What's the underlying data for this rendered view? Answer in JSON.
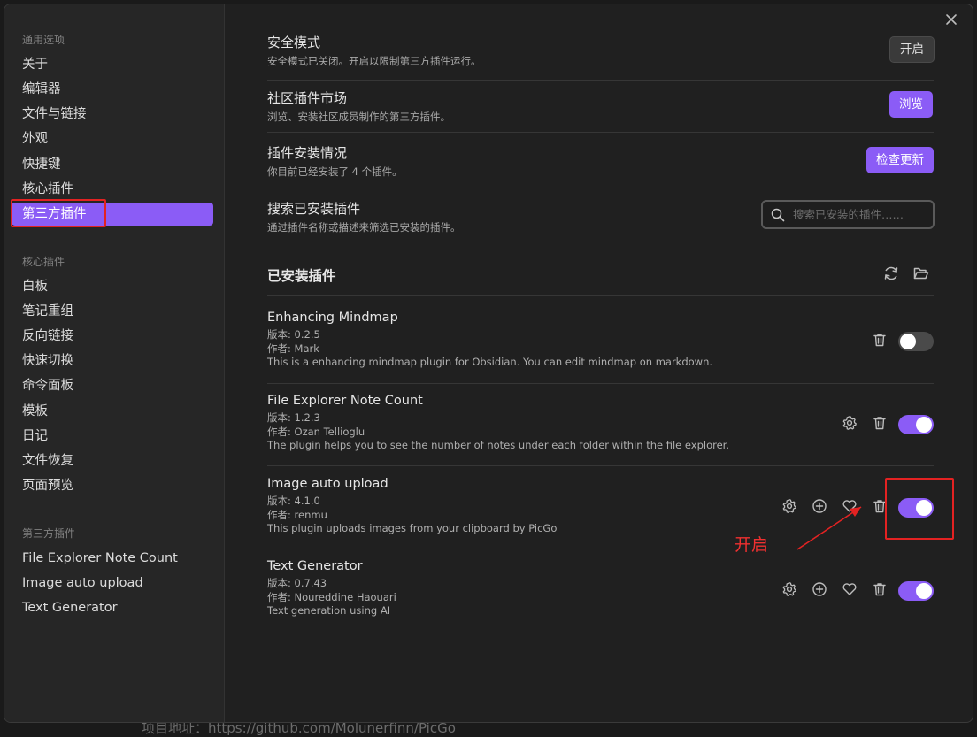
{
  "background_text": "项目地址：https://github.com/Molunerfinn/PicGo",
  "sidebar": {
    "sections": [
      {
        "heading": "通用选项",
        "items": [
          "关于",
          "编辑器",
          "文件与链接",
          "外观",
          "快捷键",
          "核心插件",
          "第三方插件"
        ]
      },
      {
        "heading": "核心插件",
        "items": [
          "白板",
          "笔记重组",
          "反向链接",
          "快速切换",
          "命令面板",
          "模板",
          "日记",
          "文件恢复",
          "页面预览"
        ]
      },
      {
        "heading": "第三方插件",
        "items": [
          "File Explorer Note Count",
          "Image auto upload",
          "Text Generator"
        ]
      }
    ],
    "active_item": "第三方插件"
  },
  "settings": {
    "safe_mode": {
      "title": "安全模式",
      "desc": "安全模式已关闭。开启以限制第三方插件运行。",
      "button": "开启"
    },
    "community": {
      "title": "社区插件市场",
      "desc": "浏览、安装社区成员制作的第三方插件。",
      "button": "浏览"
    },
    "install_status": {
      "title": "插件安装情况",
      "desc": "你目前已经安装了 4 个插件。",
      "button": "检查更新"
    },
    "search": {
      "title": "搜索已安装插件",
      "desc": "通过插件名称或描述来筛选已安装的插件。",
      "placeholder": "搜索已安装的插件……"
    }
  },
  "installed": {
    "title": "已安装插件",
    "plugins": [
      {
        "name": "Enhancing Mindmap",
        "version": "版本: 0.2.5",
        "author": "作者:  Mark",
        "desc": "This is a enhancing mindmap plugin for Obsidian. You can edit mindmap on markdown.",
        "enabled": false
      },
      {
        "name": "File Explorer Note Count",
        "version": "版本: 1.2.3",
        "author": "作者:  Ozan Tellioglu",
        "desc": "The plugin helps you to see the number of notes under each folder within the file explorer.",
        "enabled": true
      },
      {
        "name": "Image auto upload",
        "version": "版本: 4.1.0",
        "author": "作者:  renmu",
        "desc": "This plugin uploads images from your clipboard by PicGo",
        "enabled": true
      },
      {
        "name": "Text Generator",
        "version": "版本: 0.7.43",
        "author": "作者:  Noureddine Haouari",
        "desc": "Text generation using AI",
        "enabled": true
      }
    ]
  },
  "annotation": {
    "label": "开启",
    "color": "#e32222"
  },
  "colors": {
    "accent": "#8b5cf6",
    "background": "#202020",
    "sidebar": "#262626"
  }
}
